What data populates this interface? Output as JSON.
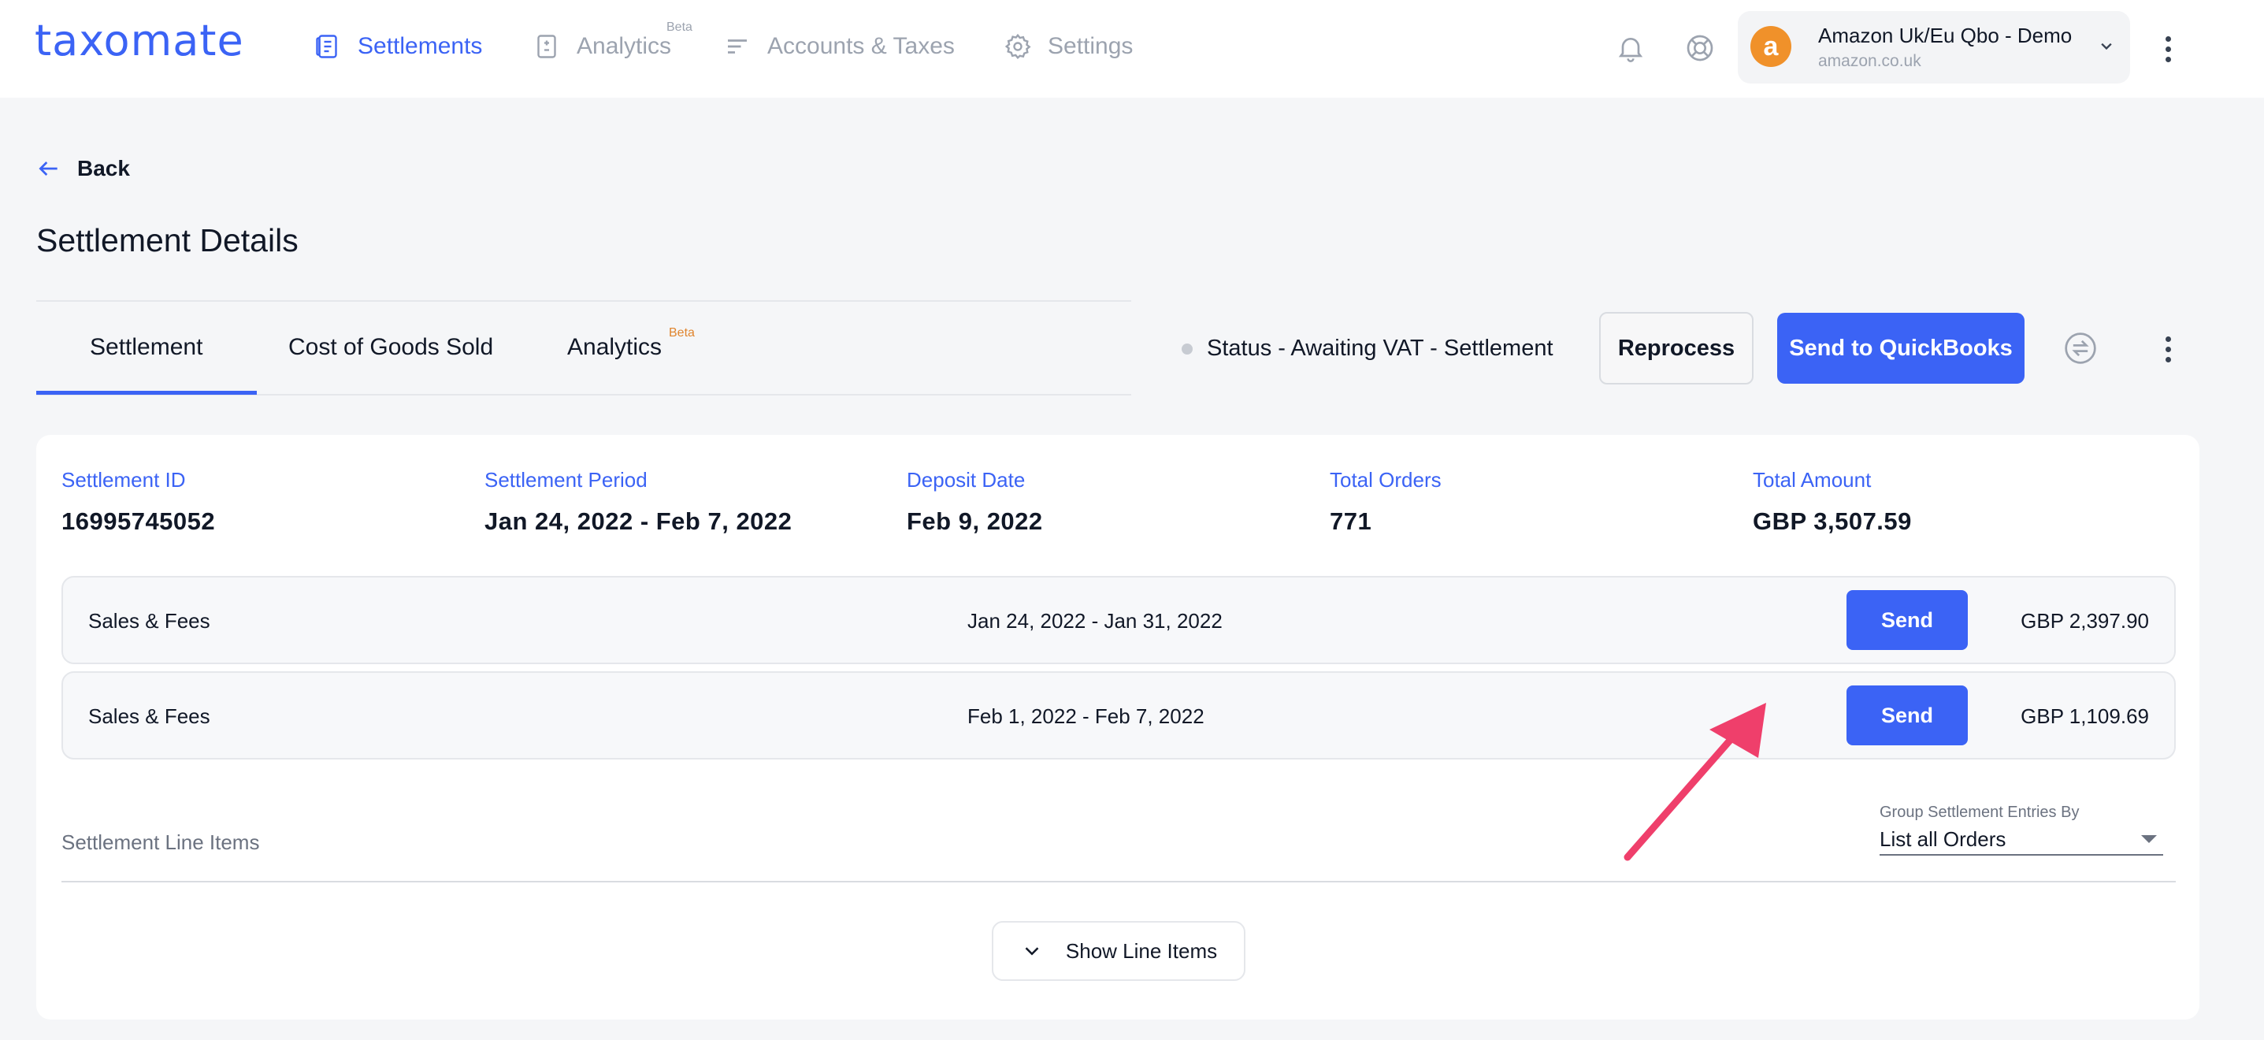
{
  "brand": {
    "logo_text": "taxomate",
    "color": "#3b63f5"
  },
  "nav": {
    "items": [
      {
        "label": "Settlements",
        "icon": "document-list-icon",
        "active": true
      },
      {
        "label": "Analytics",
        "icon": "calculator-icon",
        "badge": "Beta"
      },
      {
        "label": "Accounts & Taxes",
        "icon": "filter-lines-icon"
      },
      {
        "label": "Settings",
        "icon": "gear-icon"
      }
    ]
  },
  "header_icons": [
    "bell-icon",
    "help-lifebuoy-icon"
  ],
  "account": {
    "name": "Amazon Uk/Eu Qbo - Demo",
    "domain": "amazon.co.uk",
    "avatar_letter": "a",
    "avatar_color": "#f0912a"
  },
  "page": {
    "back_label": "Back",
    "title": "Settlement Details"
  },
  "tabs": [
    {
      "label": "Settlement",
      "active": true
    },
    {
      "label": "Cost of Goods Sold"
    },
    {
      "label": "Analytics",
      "badge": "Beta"
    }
  ],
  "status": {
    "text": "Status - Awaiting VAT - Settlement",
    "reprocess_label": "Reprocess",
    "send_label": "Send to QuickBooks"
  },
  "summary": [
    {
      "label": "Settlement ID",
      "value": "16995745052"
    },
    {
      "label": "Settlement Period",
      "value": "Jan 24, 2022 - Feb 7, 2022"
    },
    {
      "label": "Deposit Date",
      "value": "Feb 9, 2022"
    },
    {
      "label": "Total Orders",
      "value": "771"
    },
    {
      "label": "Total Amount",
      "value": "GBP 3,507.59"
    }
  ],
  "rows": [
    {
      "label": "Sales & Fees",
      "period": "Jan 24, 2022 - Jan 31, 2022",
      "button": "Send",
      "amount": "GBP 2,397.90"
    },
    {
      "label": "Sales & Fees",
      "period": "Feb 1, 2022 - Feb 7, 2022",
      "button": "Send",
      "amount": "GBP 1,109.69"
    }
  ],
  "line_items": {
    "title": "Settlement Line Items",
    "group_label": "Group Settlement Entries By",
    "group_value": "List all Orders",
    "show_label": "Show Line Items"
  },
  "colors": {
    "accent": "#3b63f5",
    "beta_tab": "#e0852e",
    "annotation_arrow": "#ef3f6b"
  }
}
